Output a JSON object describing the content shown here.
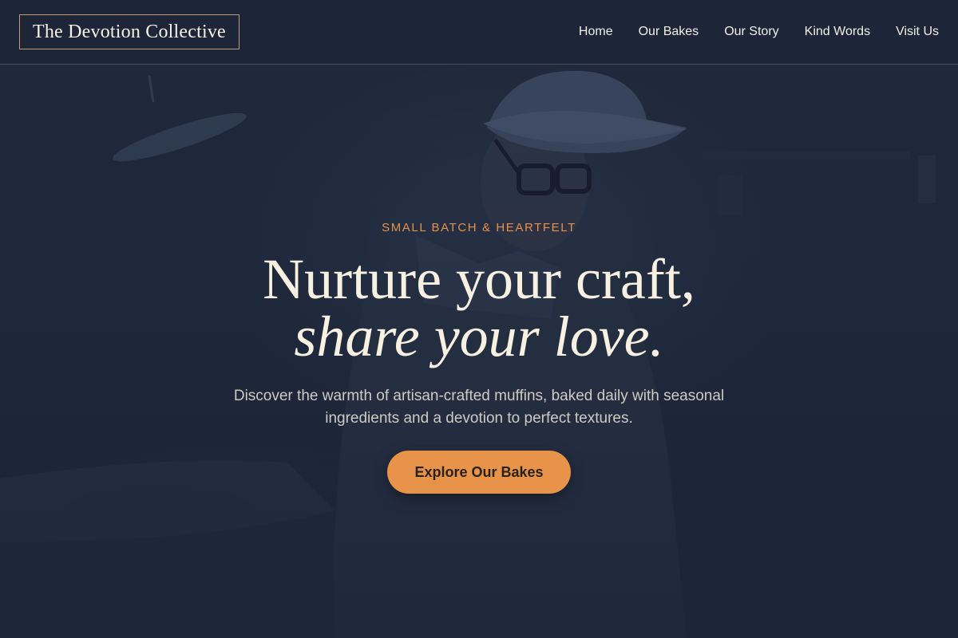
{
  "header": {
    "logo": "The Devotion Collective",
    "nav": [
      {
        "label": "Home"
      },
      {
        "label": "Our Bakes"
      },
      {
        "label": "Our Story"
      },
      {
        "label": "Kind Words"
      },
      {
        "label": "Visit Us"
      }
    ]
  },
  "hero": {
    "eyebrow": "SMALL BATCH & HEARTFELT",
    "headline_line1": "Nurture your craft,",
    "headline_line2": "share your love.",
    "description": "Discover the warmth of artisan-crafted muffins, baked daily with seasonal ingredients and a devotion to perfect textures.",
    "cta_label": "Explore Our Bakes",
    "background_image": "baker-in-cap-and-glasses-working-icon"
  },
  "colors": {
    "background": "#1d2639",
    "accent": "#e8934a",
    "headline": "#f8f1e2",
    "logo_border": "#c79a74"
  }
}
